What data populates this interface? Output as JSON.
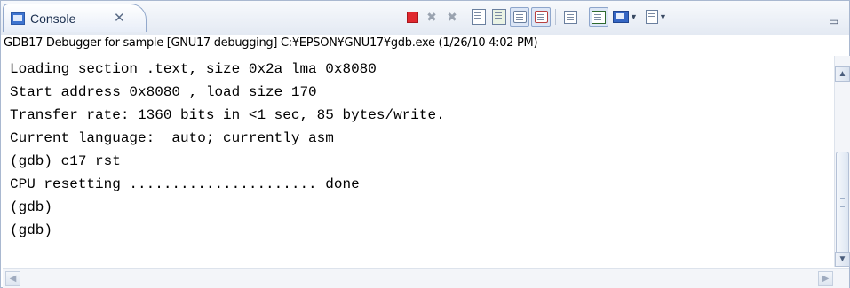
{
  "tab": {
    "label": "Console",
    "close": "✕"
  },
  "toolbar": [
    {
      "name": "terminate-icon"
    },
    {
      "name": "remove-launch-icon"
    },
    {
      "name": "remove-all-terminated-icon"
    },
    {
      "name": "clear-console-icon"
    },
    {
      "name": "scroll-lock-icon"
    },
    {
      "name": "show-console-on-stdout-icon"
    },
    {
      "name": "show-console-on-stderr-icon"
    },
    {
      "name": "pin-console-icon"
    },
    {
      "name": "display-selected-console-icon"
    },
    {
      "name": "open-console-icon"
    }
  ],
  "process_description": "GDB17 Debugger for sample [GNU17 debugging] C:¥EPSON¥GNU17¥gdb.exe (1/26/10 4:02 PM)",
  "console_lines": [
    "Loading section .text, size 0x2a lma 0x8080",
    "Start address 0x8080 , load size 170",
    "Transfer rate: 1360 bits in <1 sec, 85 bytes/write.",
    "Current language:  auto; currently asm",
    "(gdb) c17 rst",
    "CPU resetting ...................... done",
    "(gdb)",
    "(gdb)"
  ],
  "colors": {
    "terminate": "#e0282e",
    "accent": "#3566c4",
    "border": "#a9b8d0"
  }
}
